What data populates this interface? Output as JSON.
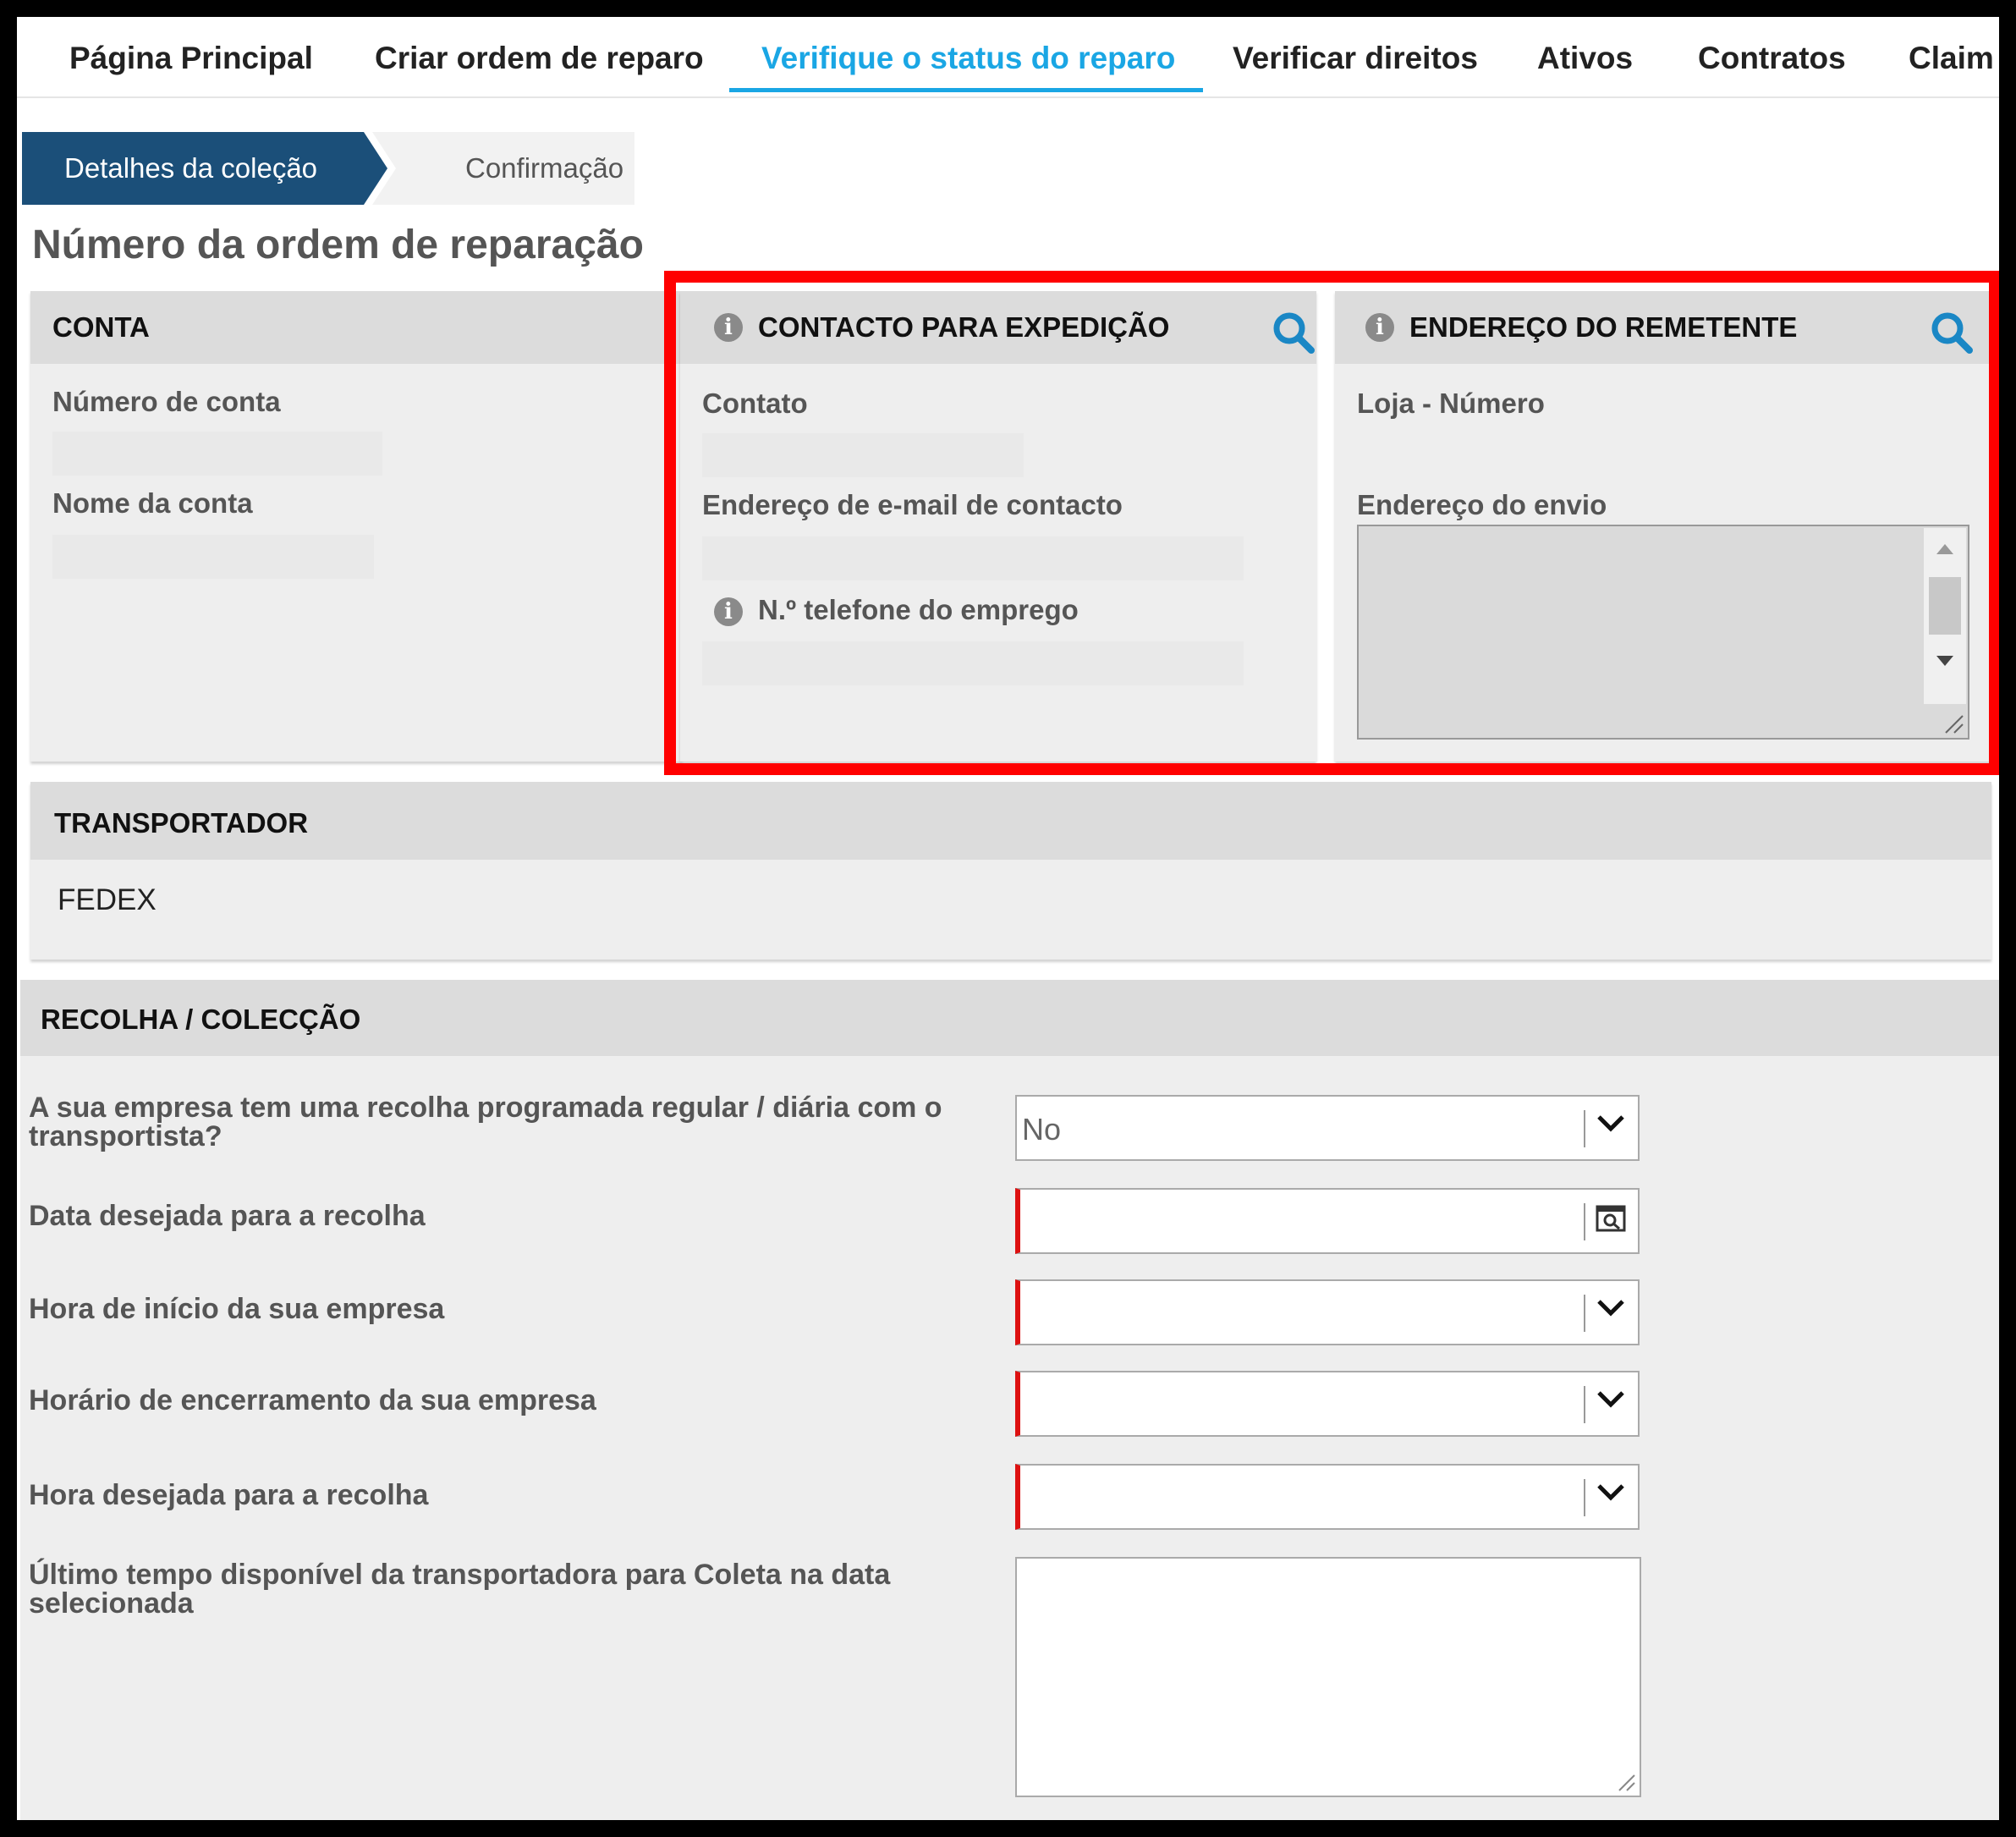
{
  "nav": {
    "items": [
      "Página Principal",
      "Criar ordem de reparo",
      "Verifique o status do reparo",
      "Verificar direitos",
      "Ativos",
      "Contratos",
      "Claim"
    ],
    "active_index": 2
  },
  "wizard": {
    "steps": [
      "Detalhes da coleção",
      "Confirmação"
    ],
    "active_index": 0
  },
  "page_title": "Número da ordem de reparação",
  "conta": {
    "title": "CONTA",
    "account_number_label": "Número de conta",
    "account_name_label": "Nome da conta"
  },
  "contacto": {
    "title": "CONTACTO PARA EXPEDIÇÃO",
    "contact_label": "Contato",
    "email_label": "Endereço de e-mail de contacto",
    "phone_label": "N.º telefone do emprego"
  },
  "remetente": {
    "title": "ENDEREÇO DO REMETENTE",
    "store_label": "Loja - Número",
    "shipping_address_label": "Endereço do envio"
  },
  "transportador": {
    "title": "TRANSPORTADOR",
    "value": "FEDEX"
  },
  "recolha": {
    "title": "RECOLHA / COLECÇÃO",
    "fields": [
      {
        "label": "A sua empresa tem uma recolha programada regular / diária com o transportista?",
        "value": "No"
      },
      {
        "label": "Data desejada para a recolha",
        "value": ""
      },
      {
        "label": "Hora de início da sua empresa",
        "value": ""
      },
      {
        "label": "Horário de encerramento da sua empresa",
        "value": ""
      },
      {
        "label": "Hora desejada para a recolha",
        "value": ""
      },
      {
        "label": "Último tempo disponível da transportadora para Coleta na data selecionada",
        "value": ""
      }
    ]
  },
  "colors": {
    "nav_active": "#1aa6e4",
    "wizard_active_bg": "#1b4f79",
    "highlight": "#ff0000",
    "required_marker": "#d11111"
  }
}
